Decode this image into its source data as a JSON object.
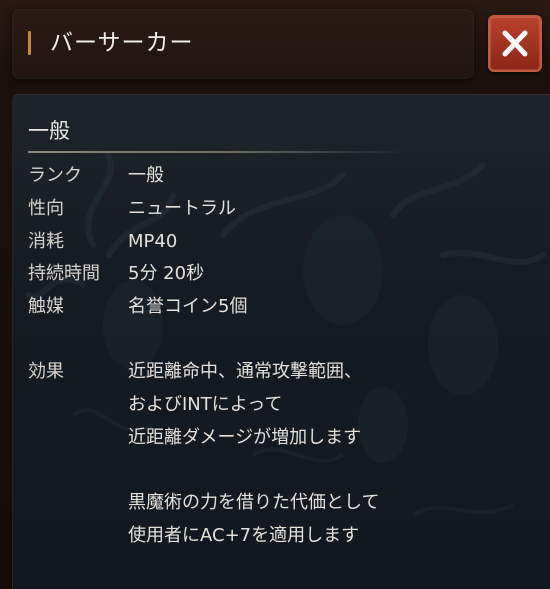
{
  "title": "バーサーカー",
  "section": {
    "heading": "一般"
  },
  "stats": [
    {
      "label": "ランク",
      "value": "一般"
    },
    {
      "label": "性向",
      "value": "ニュートラル"
    },
    {
      "label": "消耗",
      "value": "MP40"
    },
    {
      "label": "持続時間",
      "value": "5分 20秒"
    },
    {
      "label": "触媒",
      "value": "名誉コイン5個"
    }
  ],
  "effect": {
    "label": "効果",
    "lines": [
      "近距離命中、通常攻撃範囲、",
      "およびINTによって",
      "近距離ダメージが増加します",
      "",
      "黒魔術の力を借りた代価として",
      "使用者にAC+7を適用します"
    ]
  },
  "colors": {
    "accent": "#c7893f",
    "close_button": "#a7341f",
    "panel": "#151b22",
    "text": "#e4e0db"
  },
  "icons": {
    "close": "close-icon"
  }
}
